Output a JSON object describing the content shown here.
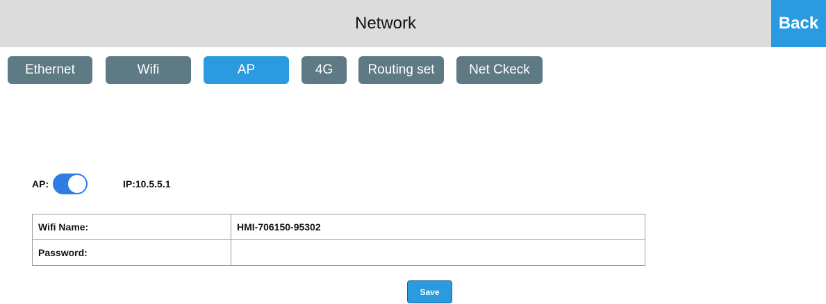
{
  "header": {
    "title": "Network",
    "back_label": "Back"
  },
  "tabs": [
    {
      "label": "Ethernet",
      "active": false
    },
    {
      "label": "Wifi",
      "active": false
    },
    {
      "label": "AP",
      "active": true
    },
    {
      "label": "4G",
      "active": false
    },
    {
      "label": "Routing set",
      "active": false
    },
    {
      "label": "Net Ckeck",
      "active": false
    }
  ],
  "ap": {
    "label": "AP:",
    "enabled": true,
    "ip_text": "IP:10.5.5.1"
  },
  "form": {
    "wifi_name_label": "Wifi Name:",
    "wifi_name_value": "HMI-706150-95302",
    "password_label": "Password:",
    "password_value": ""
  },
  "save_label": "Save",
  "colors": {
    "accent": "#2a9be0",
    "tab_inactive": "#5e7a85",
    "toggle_on": "#2f7de1",
    "header_bg": "#dcdcdc"
  }
}
